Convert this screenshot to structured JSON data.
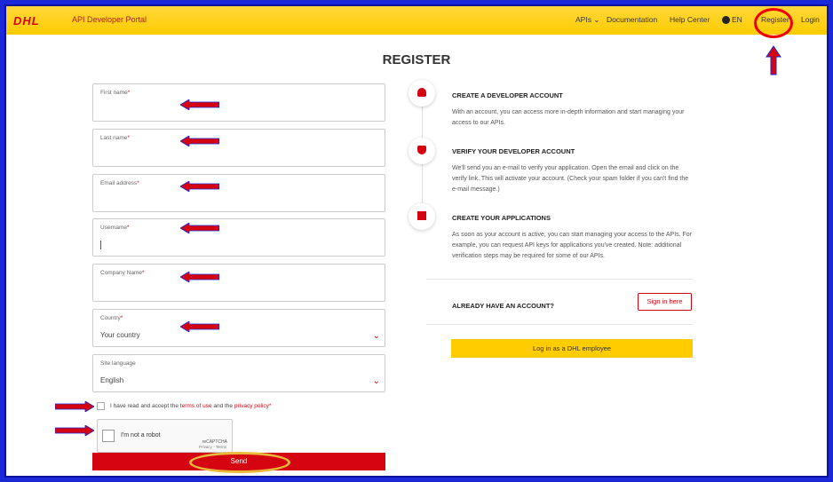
{
  "header": {
    "logo": "DHL",
    "portal_name": "API Developer Portal",
    "nav": {
      "apis": "APIs",
      "documentation": "Documentation",
      "help_center": "Help Center",
      "language": "EN",
      "register": "Register",
      "login": "Login"
    }
  },
  "page_title": "REGISTER",
  "form": {
    "first_name_label": "First name",
    "last_name_label": "Last name",
    "email_label": "Email address",
    "username_label": "Username",
    "company_label": "Company Name",
    "country_label": "Country",
    "country_value": "Your country",
    "site_language_label": "Site language",
    "site_language_value": "English",
    "required_mark": "*",
    "terms_prefix": "I have read and accept the ",
    "terms_link": "terms of use",
    "terms_and": " and the ",
    "privacy_link": "privacy policy",
    "captcha_text": "I'm not a robot",
    "captcha_brand": "reCAPTCHA",
    "captcha_links": "Privacy - Terms",
    "send_label": "Send"
  },
  "steps": [
    {
      "title": "CREATE A DEVELOPER ACCOUNT",
      "text": "With an account, you can access more in-depth information and start managing your access to our APIs.",
      "icon": "user-icon"
    },
    {
      "title": "VERIFY YOUR DEVELOPER ACCOUNT",
      "text": "We'll send you an e-mail to verify your application. Open the email and click on the verify link. This will activate your account. (Check your spam folder if you can't find the e-mail message.)",
      "icon": "shield-check-icon"
    },
    {
      "title": "CREATE YOUR APPLICATIONS",
      "text": "As soon as your account is active, you can start managing your access to the APIs. For example, you can request API keys for applications you've created. Note: additional verification steps may be required for some of our APIs.",
      "icon": "apps-icon"
    }
  ],
  "account": {
    "already_label": "ALREADY HAVE AN ACCOUNT?",
    "sign_in_label": "Sign in here",
    "employee_label": "Log in as a DHL employee"
  },
  "colors": {
    "brand_yellow": "#ffcc00",
    "brand_red": "#d40511",
    "frame_blue": "#1a28d8"
  }
}
